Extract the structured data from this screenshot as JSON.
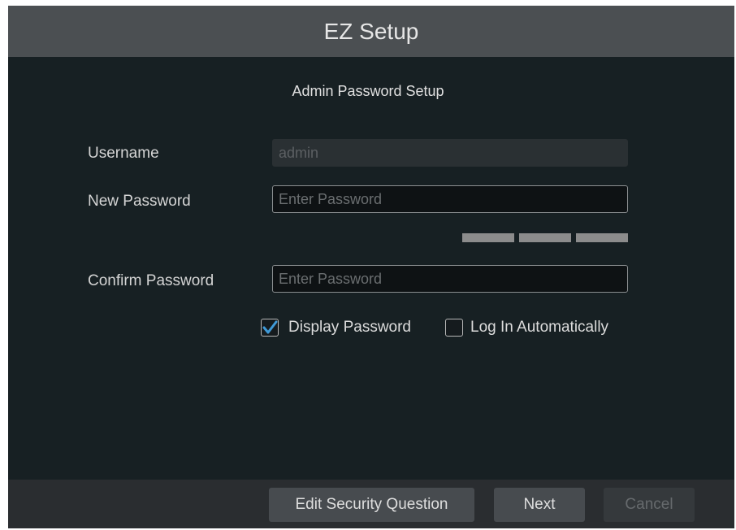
{
  "window": {
    "title": "EZ Setup"
  },
  "section_title": "Admin Password Setup",
  "form": {
    "username_label": "Username",
    "username_value": "admin",
    "new_password_label": "New Password",
    "new_password_placeholder": "Enter Password",
    "confirm_password_label": "Confirm Password",
    "confirm_password_placeholder": "Enter Password",
    "password_strength_segments": 3
  },
  "options": {
    "display_password_label": "Display Password",
    "display_password_checked": true,
    "log_in_automatically_label": "Log In Automatically",
    "log_in_automatically_checked": false
  },
  "footer": {
    "edit_security_question_label": "Edit Security Question",
    "next_label": "Next",
    "cancel_label": "Cancel"
  },
  "colors": {
    "title_bar": "#4b4f52",
    "background": "#172023",
    "check_mark": "#3f9ad8"
  }
}
